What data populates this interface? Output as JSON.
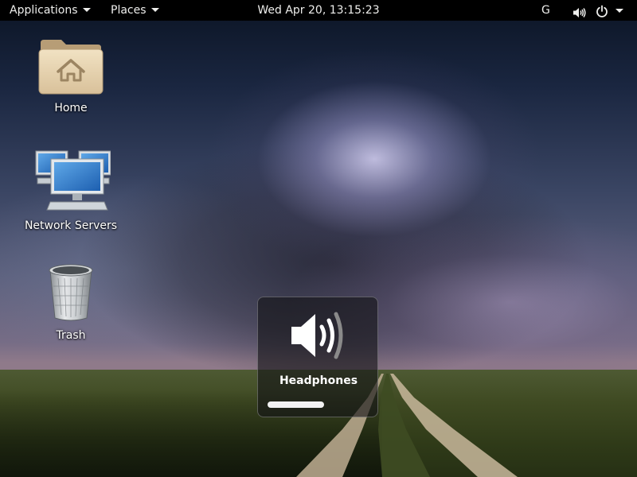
{
  "topbar": {
    "applications_label": "Applications",
    "places_label": "Places",
    "clock": "Wed Apr 20, 13:15:23",
    "input_method": "G",
    "volume_icon": "speaker-volume-icon",
    "power_icon": "power-icon",
    "menu_arrow_icon": "chevron-down-icon"
  },
  "desktop": {
    "icons": [
      {
        "label": "Home",
        "icon": "home-folder-icon"
      },
      {
        "label": "Network Servers",
        "icon": "network-servers-icon"
      },
      {
        "label": "Trash",
        "icon": "trash-icon"
      }
    ]
  },
  "osd": {
    "icon": "speaker-volume-icon",
    "label": "Headphones",
    "level_fraction": 0.56
  },
  "colors": {
    "topbar_bg": "#000000",
    "topbar_text": "#eeeeec",
    "osd_bg": "rgba(20,20,22,0.62)",
    "level_fill": "#f2f2f2"
  }
}
